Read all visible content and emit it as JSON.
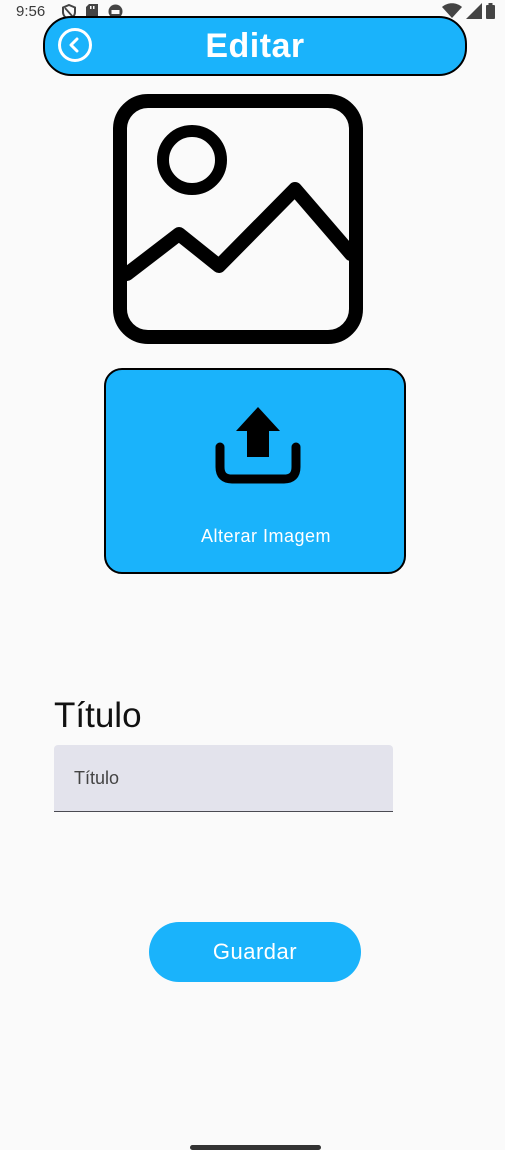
{
  "status_bar": {
    "time": "9:56",
    "icons_left": [
      "shield-icon",
      "sd-card-icon",
      "circle-app-icon"
    ],
    "icons_right": [
      "wifi-icon",
      "signal-icon",
      "battery-icon"
    ]
  },
  "header": {
    "title": "Editar",
    "back_icon": "chevron-left-icon",
    "color": "#1ab3fb"
  },
  "image_preview": {
    "icon": "image-placeholder-icon"
  },
  "upload": {
    "icon": "upload-icon",
    "label": "Alterar Imagem"
  },
  "form": {
    "title_heading": "Título",
    "title_field": {
      "value": "",
      "placeholder": "Título"
    }
  },
  "actions": {
    "save_label": "Guardar"
  }
}
